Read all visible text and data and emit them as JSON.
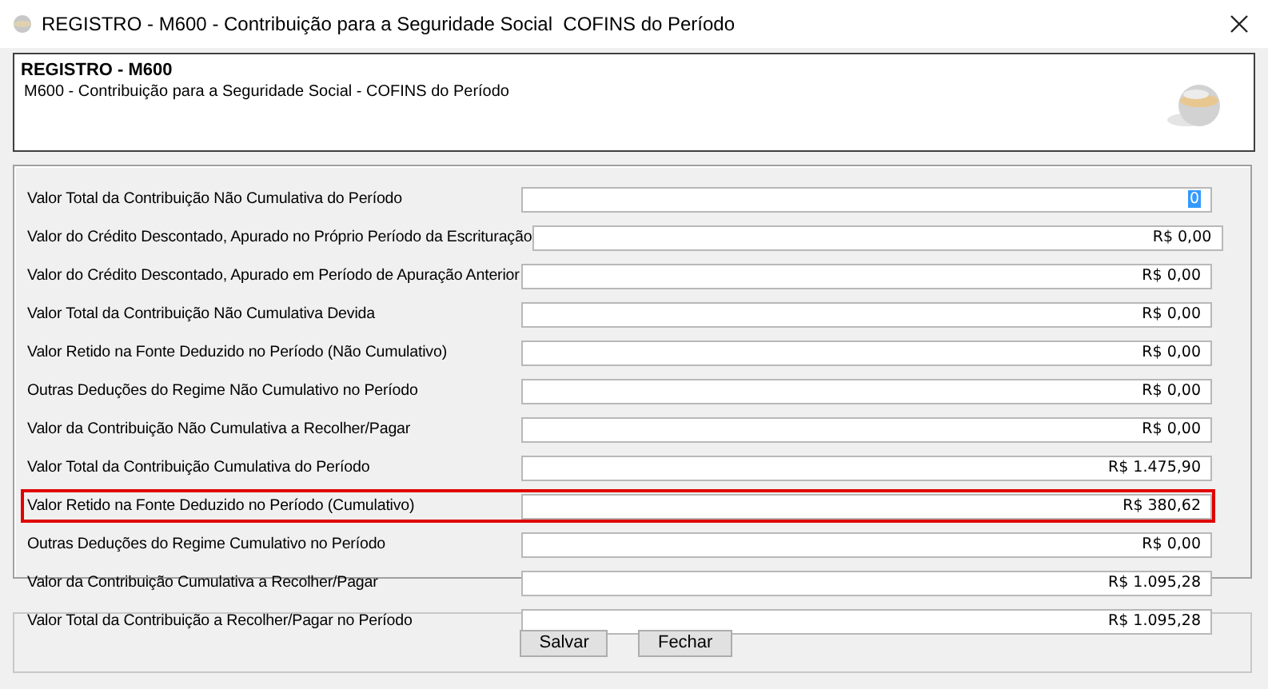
{
  "window": {
    "title": "REGISTRO - M600 - Contribuição para a Seguridade Social  COFINS do Período"
  },
  "header": {
    "title": "REGISTRO - M600",
    "subtitle": "M600 - Contribuição para a Seguridade Social - COFINS do Período"
  },
  "rows": [
    {
      "label": "Valor Total da Contribuição Não Cumulativa do Período",
      "value": "0",
      "text_highlighted": true,
      "outlined": false
    },
    {
      "label": "Valor do Crédito Descontado, Apurado no Próprio Período da Escrituração",
      "value": "R$ 0,00",
      "text_highlighted": false,
      "outlined": false
    },
    {
      "label": "Valor do Crédito Descontado, Apurado em Período de Apuração Anterior",
      "value": "R$ 0,00",
      "text_highlighted": false,
      "outlined": false
    },
    {
      "label": "Valor Total da Contribuição Não Cumulativa Devida",
      "value": "R$ 0,00",
      "text_highlighted": false,
      "outlined": false
    },
    {
      "label": "Valor Retido na Fonte Deduzido no Período (Não Cumulativo)",
      "value": "R$ 0,00",
      "text_highlighted": false,
      "outlined": false
    },
    {
      "label": "Outras Deduções do Regime Não Cumulativo no Período",
      "value": "R$ 0,00",
      "text_highlighted": false,
      "outlined": false
    },
    {
      "label": "Valor da Contribuição Não Cumulativa a Recolher/Pagar",
      "value": "R$ 0,00",
      "text_highlighted": false,
      "outlined": false
    },
    {
      "label": "Valor Total da Contribuição Cumulativa do Período",
      "value": "R$ 1.475,90",
      "text_highlighted": false,
      "outlined": false
    },
    {
      "label": "Valor Retido na Fonte Deduzido no Período (Cumulativo)",
      "value": "R$ 380,62",
      "text_highlighted": false,
      "outlined": true
    },
    {
      "label": "Outras Deduções do Regime Cumulativo no Período",
      "value": "R$ 0,00",
      "text_highlighted": false,
      "outlined": false
    },
    {
      "label": "Valor da Contribuição Cumulativa a Recolher/Pagar",
      "value": "R$ 1.095,28",
      "text_highlighted": false,
      "outlined": false
    },
    {
      "label": "Valor Total da Contribuição a Recolher/Pagar no Período",
      "value": "R$ 1.095,28",
      "text_highlighted": false,
      "outlined": false
    }
  ],
  "buttons": [
    "Salvar",
    "Fechar"
  ]
}
